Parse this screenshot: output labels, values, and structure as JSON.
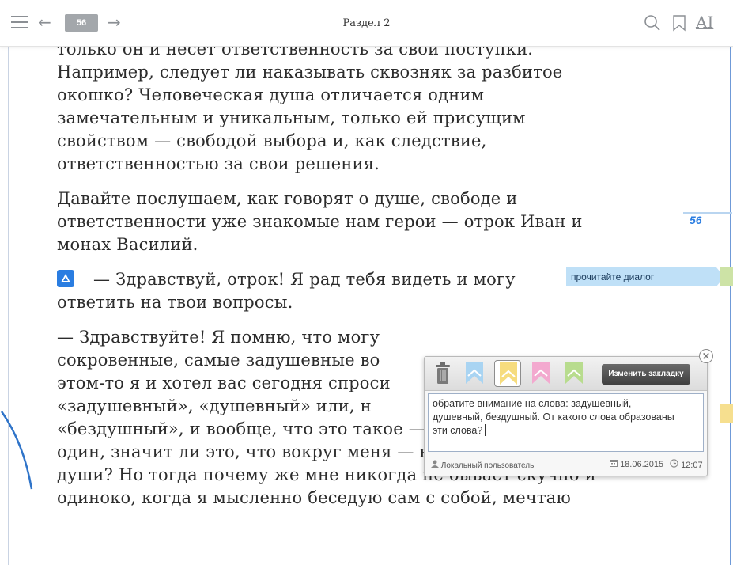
{
  "toolbar": {
    "page_number": "56",
    "section_title": "Раздел 2",
    "icons": [
      "menu-icon",
      "back-arrow-icon",
      "forward-arrow-icon",
      "search-icon",
      "bookmark-icon",
      "font-size-icon"
    ]
  },
  "content": {
    "paragraph1": [
      "только он и несёт ответственность за свои поступки.",
      "Например, следует ли наказывать сквозняк за разбитое",
      "окошко? Человеческая душа отличается одним",
      "замечательным и уникальным, только ей присущим",
      "свойством — свободой выбора и, как следствие,",
      "ответственностью за свои решения."
    ],
    "paragraph2": [
      "Давайте послушаем, как говорят о душе, свободе и",
      "ответственности уже знакомые нам герои — отрок Иван и",
      "монах Василий."
    ],
    "paragraph3": [
      "— Здравствуй, отрок! Я рад тебя видеть и могу",
      "ответить на твои вопросы."
    ],
    "paragraph4": [
      "— Здравствуйте! Я помню, что могу",
      "сокровенные, самые задушевные во",
      "этом-то я и хотел вас сегодня спроси",
      "«задушевный», «душевный» или, н",
      "«бездушный», и вообще, что это такое — душа? Когда я",
      "один, значит ли это, что вокруг меня — ни единой живой",
      "души? Но тогда почему же мне никогда не бывает скучно и",
      "одиноко, когда я мысленно беседую сам с собой, мечтаю"
    ]
  },
  "margin": {
    "page_number": "56",
    "hint_label": "прочитайте диалог"
  },
  "note": {
    "change_button": "Изменить закладку",
    "text_line1": "обратите внимание  на слова: задушевный,",
    "text_line2": "душевный, бездушный. От какого слова образованы",
    "text_line3": "эти слова?",
    "user": "Локальный пользователь",
    "date": "18.06.2015",
    "time": "12:07",
    "flag_colors": [
      "#a9d4f2",
      "#f6dc7e",
      "#f3a9cf",
      "#b8dc8e"
    ]
  },
  "colors": {
    "accent": "#2a7de1",
    "hint_bg": "#bfe0f7"
  }
}
